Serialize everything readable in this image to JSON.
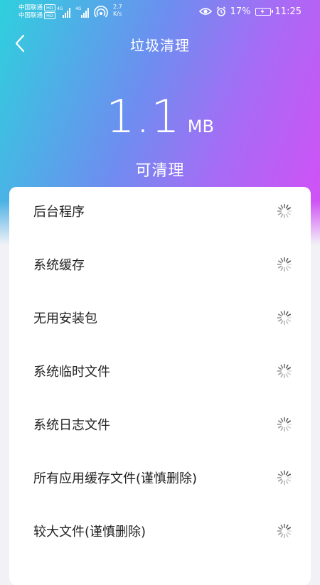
{
  "status_bar": {
    "carrier_1": "中国联通",
    "carrier_2": "中国联通",
    "hd_badge": "HD",
    "network_1": "4G",
    "network_2": "4G",
    "speed_value": "2.7",
    "speed_unit": "K/s",
    "battery_level": "17%",
    "time": "11:25"
  },
  "header": {
    "title": "垃圾清理",
    "back_icon": "chevron-left-icon"
  },
  "summary": {
    "size_value": "1.1",
    "size_unit": "MB",
    "label": "可清理"
  },
  "items": [
    {
      "label": "后台程序",
      "icon": "loading-spinner-icon"
    },
    {
      "label": "系统缓存",
      "icon": "loading-spinner-icon"
    },
    {
      "label": "无用安装包",
      "icon": "loading-spinner-icon"
    },
    {
      "label": "系统临时文件",
      "icon": "loading-spinner-icon"
    },
    {
      "label": "系统日志文件",
      "icon": "loading-spinner-icon"
    },
    {
      "label": "所有应用缓存文件(谨慎删除)",
      "icon": "loading-spinner-icon"
    },
    {
      "label": "较大文件(谨慎删除)",
      "icon": "loading-spinner-icon"
    }
  ],
  "colors": {
    "gradient_start": "#2ed0dd",
    "gradient_mid": "#a66cf5",
    "gradient_end": "#d64ef6",
    "background": "#f2f2f6",
    "card": "#ffffff",
    "text": "#222222"
  }
}
